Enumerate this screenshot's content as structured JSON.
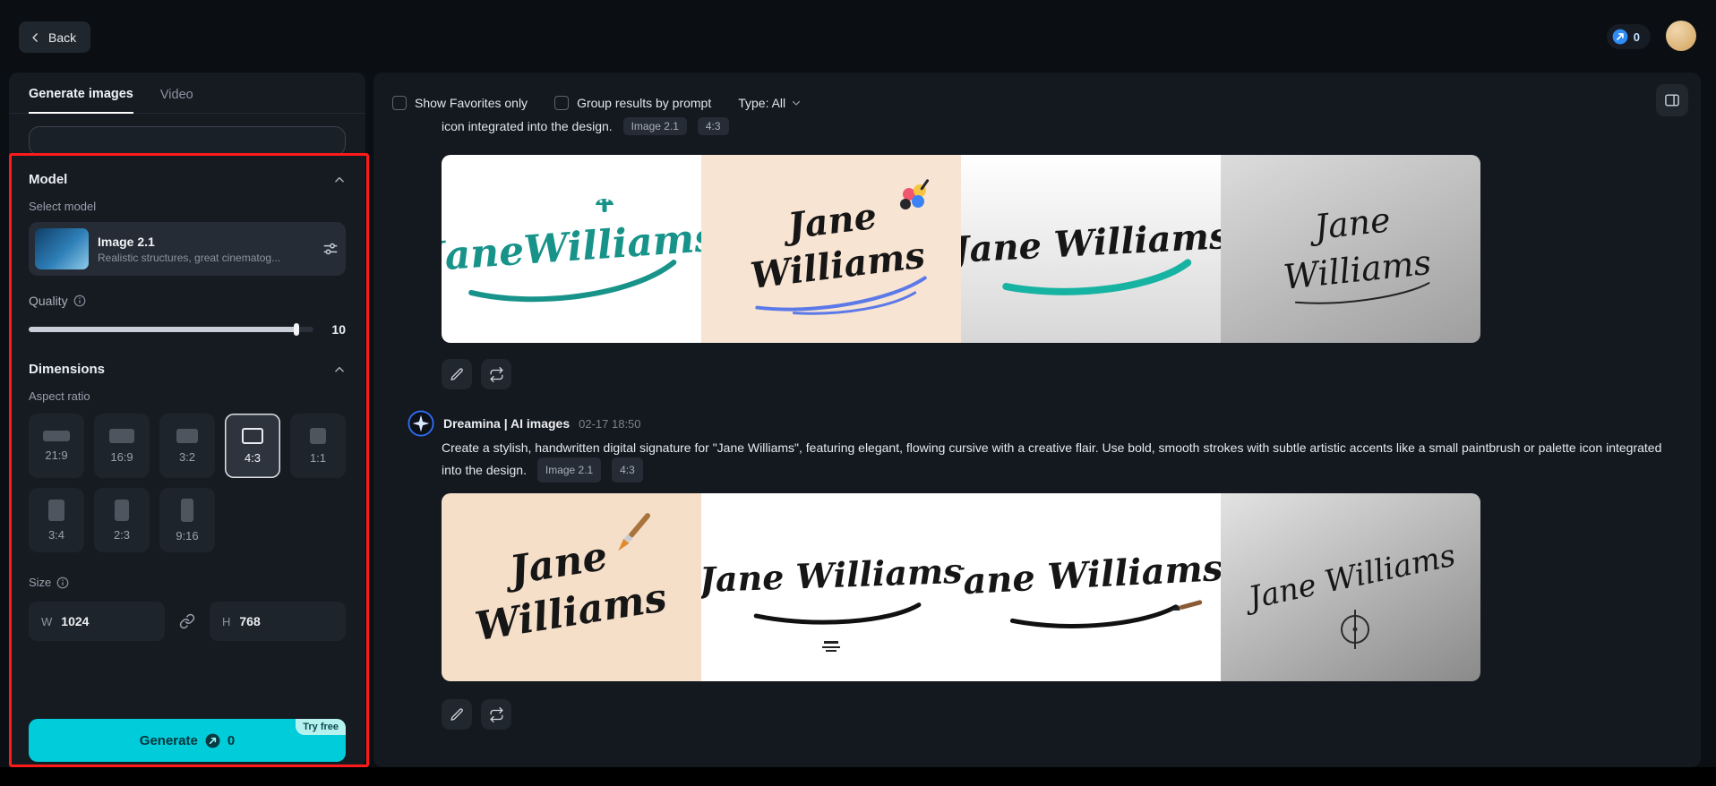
{
  "colors": {
    "accent_cyan": "#00ccda",
    "signature_teal": "#17938a",
    "annotation_red": "#ff1a1a",
    "credit_blue": "#2f8cf5"
  },
  "header": {
    "back_label": "Back",
    "credits_value": "0"
  },
  "sidebar": {
    "tabs": [
      {
        "label": "Generate images"
      },
      {
        "label": "Video"
      }
    ],
    "model": {
      "section_title": "Model",
      "select_label": "Select model",
      "card": {
        "name": "Image 2.1",
        "description": "Realistic structures, great cinematog..."
      },
      "quality_label": "Quality",
      "quality_value": "10"
    },
    "dimensions": {
      "section_title": "Dimensions",
      "aspect_label": "Aspect ratio",
      "ratios": [
        {
          "label": "21:9"
        },
        {
          "label": "16:9"
        },
        {
          "label": "3:2"
        },
        {
          "label": "4:3"
        },
        {
          "label": "1:1"
        },
        {
          "label": "3:4"
        },
        {
          "label": "2:3"
        },
        {
          "label": "9:16"
        }
      ],
      "selected_ratio": "4:3",
      "size_label": "Size",
      "width_label": "W",
      "width_value": "1024",
      "height_label": "H",
      "height_value": "768"
    },
    "generate": {
      "label": "Generate",
      "credits": "0",
      "badge": "Try free"
    }
  },
  "main": {
    "filters": {
      "favorites": "Show Favorites only",
      "group": "Group results by prompt",
      "type": "Type: All"
    },
    "message1": {
      "text": "icon integrated into the design.",
      "tags": [
        "Image 2.1",
        "4:3"
      ]
    },
    "message2": {
      "author": "Dreamina | AI images",
      "timestamp": "02-17 18:50",
      "prompt": "Create a stylish, handwritten digital signature for \"Jane Williams\", featuring elegant, flowing cursive with a creative flair. Use bold, smooth strokes with subtle artistic accents like a small paintbrush or palette icon integrated into the design.",
      "tags": [
        "Image 2.1",
        "4:3"
      ]
    },
    "signatures": {
      "row1": [
        {
          "text": "JaneWilliams"
        },
        {
          "line1": "Jane",
          "line2": "Williams"
        },
        {
          "text": "Jane Williams"
        },
        {
          "line1": "Jane",
          "line2": "Williams"
        }
      ],
      "row2": [
        {
          "line1": "Jane",
          "line2": "Williams"
        },
        {
          "text": "Jane Williams"
        },
        {
          "text": "Jane Williams"
        },
        {
          "text": "Jane Williams"
        }
      ]
    }
  }
}
